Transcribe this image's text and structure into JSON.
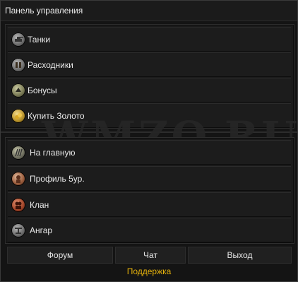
{
  "header": {
    "title": "Панель управления"
  },
  "top_menu": {
    "items": [
      {
        "label": "Танки",
        "icon": "tank-icon"
      },
      {
        "label": "Расходники",
        "icon": "consumables-icon"
      },
      {
        "label": "Бонусы",
        "icon": "bonus-icon"
      },
      {
        "label": "Купить Золото",
        "icon": "gold-icon"
      }
    ]
  },
  "bottom_menu": {
    "items": [
      {
        "label": "На главную",
        "icon": "home-icon"
      },
      {
        "label": "Профиль 5ур.",
        "icon": "profile-icon"
      },
      {
        "label": "Клан",
        "icon": "clan-icon"
      },
      {
        "label": "Ангар",
        "icon": "hangar-icon"
      }
    ]
  },
  "watermark": "WMZO.RU",
  "buttons": {
    "forum": "Форум",
    "chat": "Чат",
    "exit": "Выход"
  },
  "support": "Поддержка",
  "colors": {
    "accent": "#e3b00c",
    "background": "#141414",
    "row": "#1c1c1c"
  }
}
